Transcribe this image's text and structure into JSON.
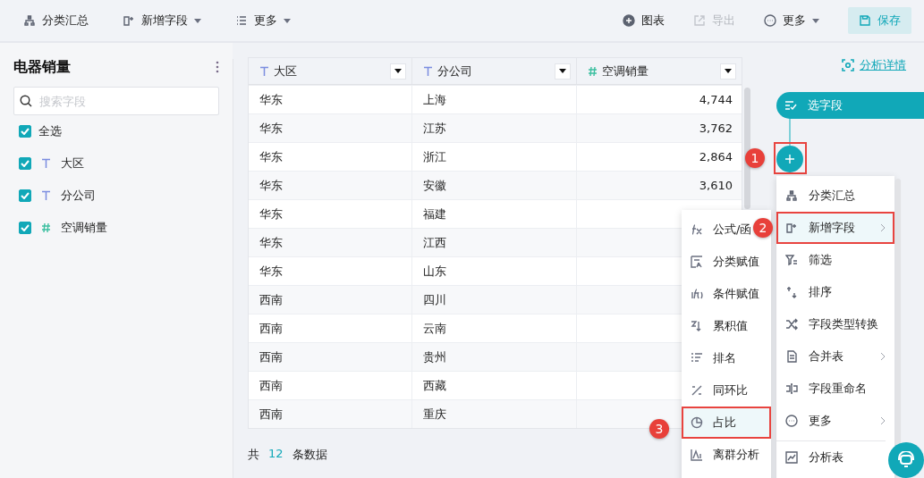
{
  "toolbar": {
    "left": [
      {
        "label": "分类汇总",
        "caret": false
      },
      {
        "label": "新增字段",
        "caret": true
      },
      {
        "label": "更多",
        "caret": true
      }
    ],
    "right": [
      {
        "label": "图表",
        "kind": "plain",
        "disabled": false,
        "caret": false
      },
      {
        "label": "导出",
        "kind": "plain",
        "disabled": true,
        "caret": false
      },
      {
        "label": "更多",
        "kind": "plain",
        "disabled": false,
        "caret": true
      },
      {
        "label": "保存",
        "kind": "primary",
        "disabled": false,
        "caret": false
      }
    ]
  },
  "dataset": {
    "title": "电器销量",
    "search": {
      "placeholder": "搜索字段"
    },
    "fields": [
      {
        "label": "全选",
        "kind": "all",
        "checked": true
      },
      {
        "label": "大区",
        "kind": "text",
        "checked": true
      },
      {
        "label": "分公司",
        "kind": "text",
        "checked": true
      },
      {
        "label": "空调销量",
        "kind": "number",
        "checked": true
      }
    ]
  },
  "table": {
    "columns": [
      {
        "label": "大区",
        "kind": "text"
      },
      {
        "label": "分公司",
        "kind": "text"
      },
      {
        "label": "空调销量",
        "kind": "number"
      }
    ],
    "rows": [
      [
        "华东",
        "上海",
        "4,744"
      ],
      [
        "华东",
        "江苏",
        "3,762"
      ],
      [
        "华东",
        "浙江",
        "2,864"
      ],
      [
        "华东",
        "安徽",
        "3,610"
      ],
      [
        "华东",
        "福建"
      ],
      [
        "华东",
        "江西"
      ],
      [
        "华东",
        "山东"
      ],
      [
        "西南",
        "四川"
      ],
      [
        "西南",
        "云南"
      ],
      [
        "西南",
        "贵州"
      ],
      [
        "西南",
        "西藏"
      ],
      [
        "西南",
        "重庆"
      ]
    ],
    "footer": {
      "prefix": "共",
      "count": "12",
      "suffix": "条数据"
    }
  },
  "analysis_link": "分析详情",
  "flow": {
    "node": "选字段"
  },
  "steps": [
    "1",
    "2",
    "3"
  ],
  "context_menu": [
    {
      "label": "分类汇总",
      "submenu": false,
      "selected": false,
      "separated": false
    },
    {
      "label": "新增字段",
      "submenu": true,
      "selected": true,
      "separated": false
    },
    {
      "label": "筛选",
      "submenu": false,
      "selected": false,
      "separated": false
    },
    {
      "label": "排序",
      "submenu": false,
      "selected": false,
      "separated": false
    },
    {
      "label": "字段类型转换",
      "submenu": false,
      "selected": false,
      "separated": false
    },
    {
      "label": "合并表",
      "submenu": true,
      "selected": false,
      "separated": false
    },
    {
      "label": "字段重命名",
      "submenu": false,
      "selected": false,
      "separated": false
    },
    {
      "label": "更多",
      "submenu": true,
      "selected": false,
      "separated": false
    },
    {
      "label": "分析表",
      "submenu": false,
      "selected": false,
      "separated": true
    }
  ],
  "submenu": [
    {
      "label": "公式/函",
      "selected": false
    },
    {
      "label": "分类赋值",
      "selected": false
    },
    {
      "label": "条件赋值",
      "selected": false
    },
    {
      "label": "累积值",
      "selected": false
    },
    {
      "label": "排名",
      "selected": false
    },
    {
      "label": "同环比",
      "selected": false
    },
    {
      "label": "占比",
      "selected": true
    },
    {
      "label": "离群分析",
      "selected": false
    }
  ]
}
